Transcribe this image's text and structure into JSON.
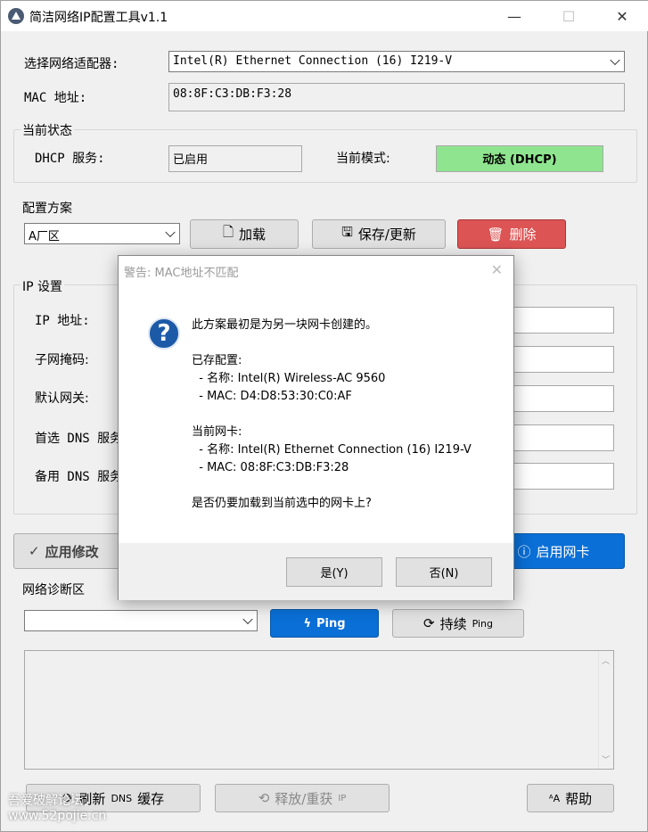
{
  "window": {
    "title": "简洁网络IP配置工具v1.1",
    "minimize": "—",
    "maximize": "☐",
    "close": "✕"
  },
  "adapter": {
    "label": "选择网络适配器:",
    "value": "Intel(R) Ethernet Connection (16) I219-V"
  },
  "mac": {
    "label": "MAC 地址:",
    "value": "08:8F:C3:DB:F3:28"
  },
  "status": {
    "title": "当前状态",
    "dhcp_label": "DHCP 服务:",
    "dhcp_value": "已启用",
    "mode_label": "当前模式:",
    "mode_value": "动态 (DHCP)",
    "mode_color": "#8fe58f"
  },
  "profile": {
    "title": "配置方案",
    "selected": "A厂区",
    "load": "加载",
    "save": "保存/更新",
    "delete": "删除"
  },
  "ip": {
    "title": "IP 设置",
    "ip_label": "IP 地址:",
    "mask_label": "子网掩码:",
    "gw_label": "默认网关:",
    "dns1_label": "首选 DNS 服务",
    "dns2_label": "备用 DNS 服务"
  },
  "actions": {
    "apply": "应用修改",
    "enable": "启用网卡"
  },
  "diag": {
    "title": "网络诊断区",
    "ping": "Ping",
    "cont_ping_main": "持续",
    "cont_ping_sub": "Ping"
  },
  "bottom": {
    "flush_main": "刷新",
    "flush_sub": "DNS",
    "flush_tail": "缓存",
    "release_main": "释放/重获",
    "release_sub": "IP",
    "help": "帮助"
  },
  "dialog": {
    "title": "警告: MAC地址不匹配",
    "line1": "此方案最初是为另一块网卡创建的。",
    "saved_head": "已存配置:",
    "saved_name": "  - 名称: Intel(R) Wireless-AC 9560",
    "saved_mac": "  - MAC: D4:D8:53:30:C0:AF",
    "cur_head": "当前网卡:",
    "cur_name": "  - 名称: Intel(R) Ethernet Connection (16) I219-V",
    "cur_mac": "  - MAC: 08:8F:C3:DB:F3:28",
    "question": "是否仍要加载到当前选中的网卡上?",
    "yes": "是(Y)",
    "no": "否(N)"
  },
  "watermark": {
    "line1": "吾爱破解论坛",
    "line2": "www.52pojie.cn"
  }
}
